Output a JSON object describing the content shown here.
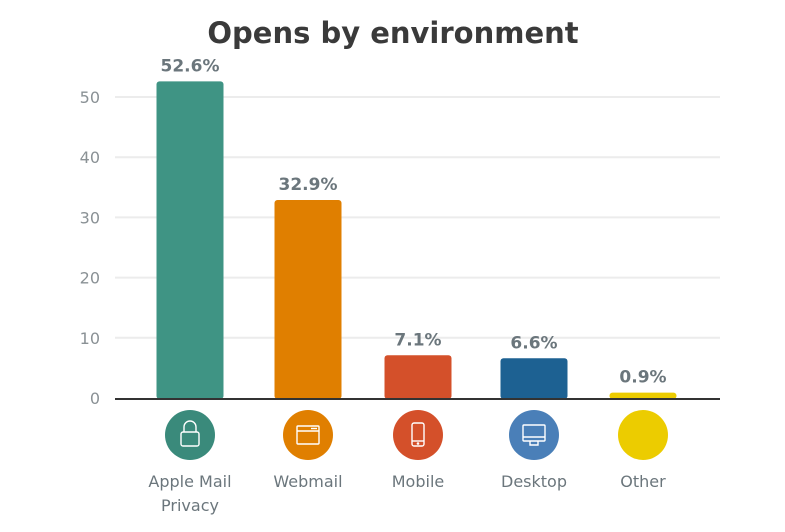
{
  "chart_data": {
    "type": "bar",
    "title": "Opens by environment",
    "xlabel": "",
    "ylabel": "",
    "ylim": [
      0,
      50
    ],
    "yticks": [
      0,
      10,
      20,
      30,
      40,
      50
    ],
    "grid": true,
    "categories": [
      {
        "label_lines": [
          "Apple Mail",
          "Privacy"
        ],
        "icon": "lock-icon"
      },
      {
        "label_lines": [
          "Webmail"
        ],
        "icon": "browser-window-icon"
      },
      {
        "label_lines": [
          "Mobile"
        ],
        "icon": "mobile-phone-icon"
      },
      {
        "label_lines": [
          "Desktop"
        ],
        "icon": "desktop-monitor-icon"
      },
      {
        "label_lines": [
          "Other"
        ],
        "icon": "none"
      }
    ],
    "values": [
      52.6,
      32.9,
      7.1,
      6.6,
      0.9
    ],
    "data_labels": [
      "52.6%",
      "32.9%",
      "7.1%",
      "6.6%",
      "0.9%"
    ],
    "colors": [
      "#3f9484",
      "#e07f00",
      "#d4502a",
      "#1d6192",
      "#eccc00"
    ],
    "icon_colors": [
      "#3a8a7b",
      "#e07f00",
      "#d4502a",
      "#4a7fb8",
      "#eccc00"
    ]
  }
}
